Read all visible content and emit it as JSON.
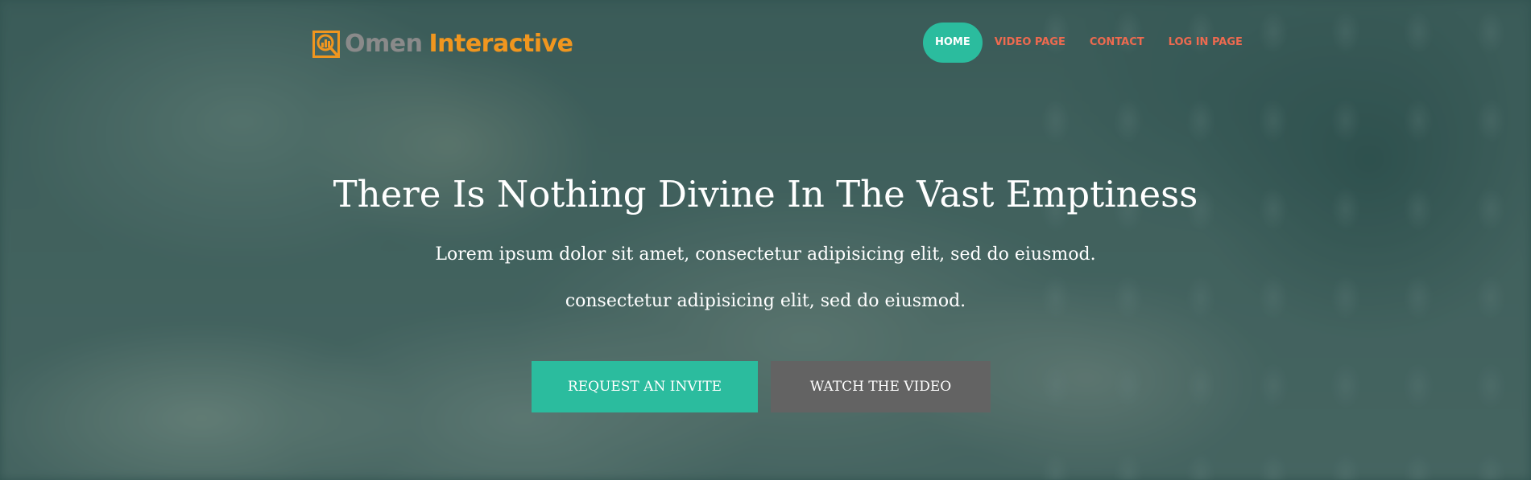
{
  "brand": {
    "name_part1": "Omen",
    "name_part2": "Interactive",
    "logo_icon": "magnifier-chart-icon",
    "colors": {
      "gray": "#8a8a8a",
      "orange": "#f0961f"
    }
  },
  "nav": {
    "items": [
      {
        "label": "HOME",
        "active": true
      },
      {
        "label": "VIDEO PAGE",
        "active": false
      },
      {
        "label": "CONTACT",
        "active": false
      },
      {
        "label": "LOG IN PAGE",
        "active": false
      }
    ],
    "colors": {
      "active_bg": "#2bbc9e",
      "link": "#ee6a4f"
    }
  },
  "hero": {
    "headline": "There Is Nothing Divine In The Vast Emptiness",
    "subtext_1": "Lorem ipsum dolor sit amet, consectetur adipisicing elit, sed do eiusmod.",
    "subtext_2": "consectetur adipisicing elit, sed do eiusmod.",
    "primary_button": "REQUEST AN INVITE",
    "secondary_button": "WATCH THE VIDEO",
    "colors": {
      "primary": "#2bbc9e",
      "secondary": "#636363",
      "overlay": "#1a4844"
    }
  }
}
